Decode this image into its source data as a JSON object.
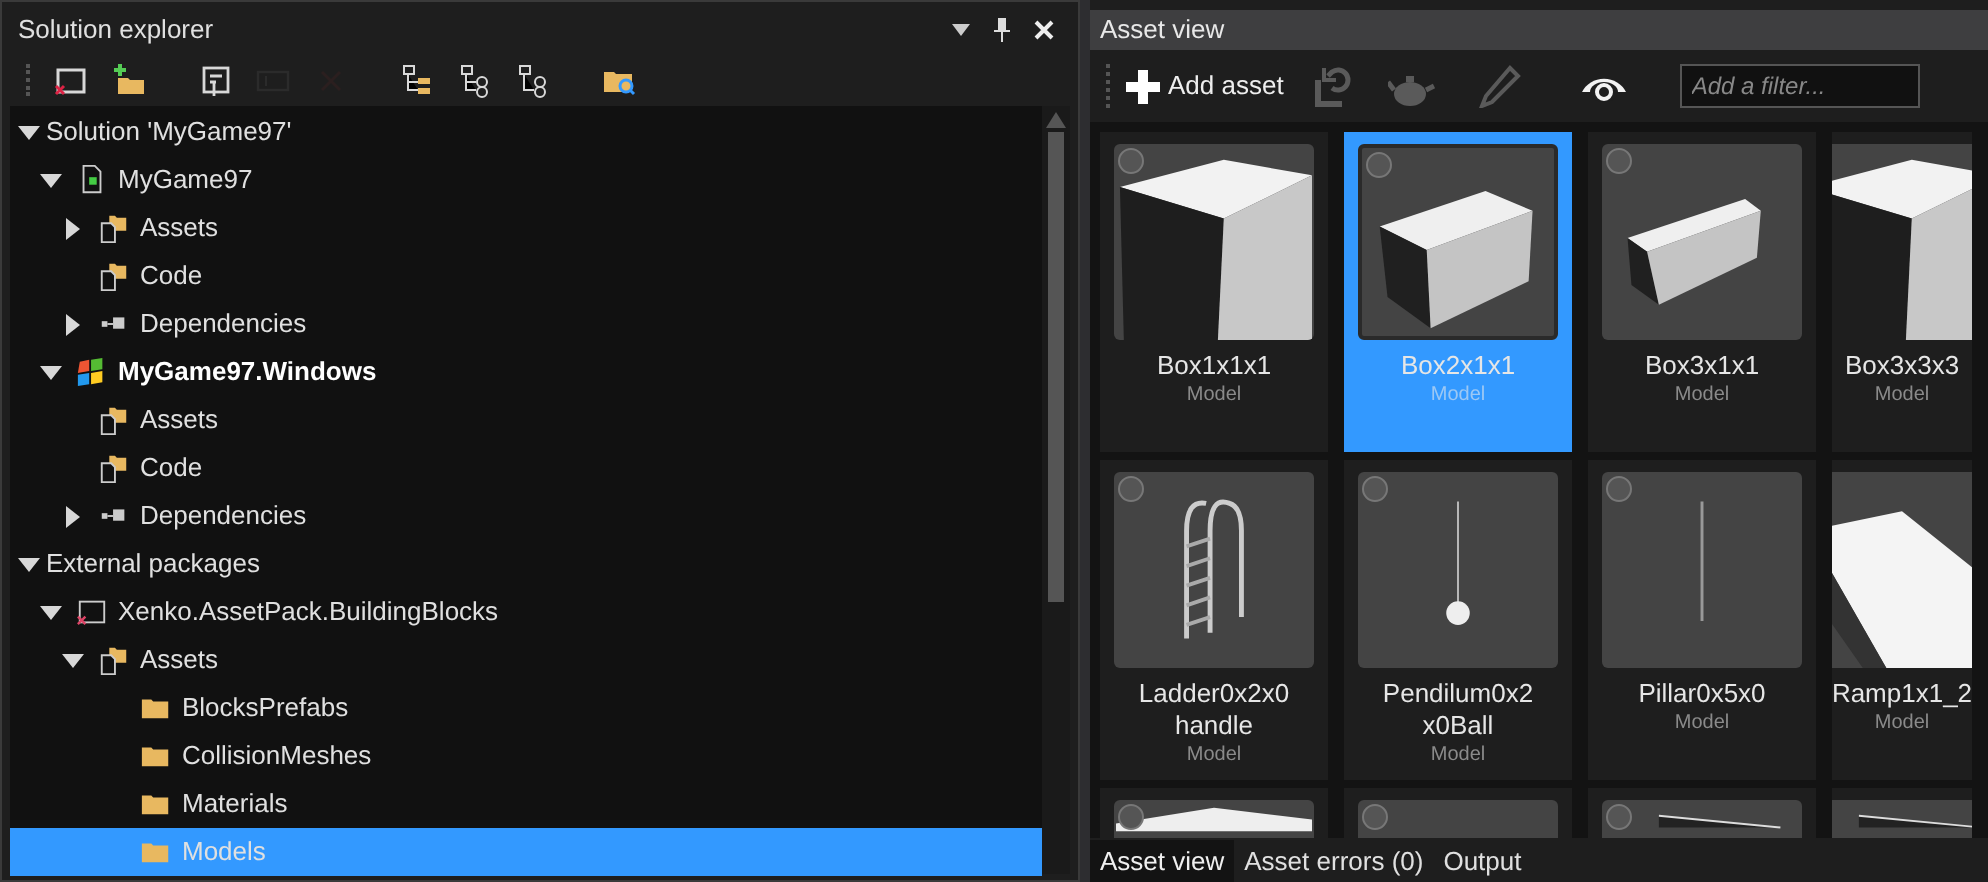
{
  "solution_explorer": {
    "title": "Solution explorer",
    "toolbar": [
      {
        "kind": "close-solution",
        "disabled": false
      },
      {
        "kind": "new-folder",
        "disabled": false
      },
      {
        "kind": "properties",
        "disabled": false
      },
      {
        "kind": "rename",
        "disabled": true
      },
      {
        "kind": "delete",
        "disabled": true
      },
      {
        "kind": "tree-a",
        "disabled": false
      },
      {
        "kind": "tree-b",
        "disabled": false
      },
      {
        "kind": "tree-c",
        "disabled": false
      },
      {
        "kind": "find-folder",
        "disabled": false
      }
    ],
    "tree": [
      {
        "label": "Solution 'MyGame97'",
        "expanded": true,
        "selected": false,
        "children": [
          {
            "label": "MyGame97",
            "kind": "project",
            "expanded": true,
            "startup": false,
            "selected": false,
            "children": [
              {
                "label": "Assets",
                "kind": "asset-folder",
                "expanded": false,
                "selected": false
              },
              {
                "label": "Code",
                "kind": "asset-folder",
                "selected": false
              },
              {
                "label": "Dependencies",
                "kind": "dependencies",
                "expanded": false,
                "selected": false
              }
            ]
          },
          {
            "label": "MyGame97.Windows",
            "kind": "windows-project",
            "expanded": true,
            "startup": true,
            "selected": false,
            "children": [
              {
                "label": "Assets",
                "kind": "asset-folder",
                "selected": false
              },
              {
                "label": "Code",
                "kind": "asset-folder",
                "selected": false
              },
              {
                "label": "Dependencies",
                "kind": "dependencies",
                "expanded": false,
                "selected": false
              }
            ]
          }
        ]
      },
      {
        "label": "External packages",
        "expanded": true,
        "selected": false,
        "children": [
          {
            "label": "Xenko.AssetPack.BuildingBlocks",
            "kind": "package",
            "expanded": true,
            "selected": false,
            "children": [
              {
                "label": "Assets",
                "kind": "asset-folder",
                "expanded": true,
                "selected": false,
                "children": [
                  {
                    "label": "BlocksPrefabs",
                    "kind": "folder",
                    "selected": false
                  },
                  {
                    "label": "CollisionMeshes",
                    "kind": "folder",
                    "selected": false
                  },
                  {
                    "label": "Materials",
                    "kind": "folder",
                    "selected": false
                  },
                  {
                    "label": "Models",
                    "kind": "folder",
                    "selected": true
                  }
                ]
              }
            ]
          }
        ]
      }
    ]
  },
  "asset_view": {
    "title": "Asset view",
    "add_button": "Add asset",
    "toolbar": [
      {
        "kind": "reimport",
        "disabled": true
      },
      {
        "kind": "teapot",
        "disabled": true
      },
      {
        "kind": "pencil",
        "disabled": true
      },
      {
        "kind": "eye",
        "disabled": false
      }
    ],
    "filter": {
      "placeholder": "Add a filter..."
    },
    "assets": [
      {
        "name": "Box1x1x1",
        "type": "Model",
        "kind": "cube",
        "selected": false
      },
      {
        "name": "Box2x1x1",
        "type": "Model",
        "kind": "box2",
        "selected": true
      },
      {
        "name": "Box3x1x1",
        "type": "Model",
        "kind": "box3",
        "selected": false
      },
      {
        "name": "Box3x3x3",
        "type": "Model",
        "kind": "cube",
        "selected": false
      },
      {
        "name": "Ladder0x2x0handle",
        "type": "Model",
        "kind": "ladder",
        "selected": false
      },
      {
        "name": "Pendilum0x2x0Ball",
        "type": "Model",
        "kind": "pendulum",
        "selected": false
      },
      {
        "name": "Pillar0x5x0",
        "type": "Model",
        "kind": "pillar",
        "selected": false
      },
      {
        "name": "Ramp1x1_2",
        "type": "Model",
        "kind": "ramp",
        "selected": false
      },
      {
        "kind": "slab",
        "selected": false
      },
      {
        "kind": "empty",
        "selected": false
      },
      {
        "kind": "wedge",
        "selected": false
      },
      {
        "kind": "wedge",
        "selected": false
      }
    ],
    "tabs": [
      {
        "label": "Asset view",
        "selected": true
      },
      {
        "label": "Asset errors (0)",
        "selected": false
      },
      {
        "label": "Output",
        "selected": false
      }
    ]
  }
}
